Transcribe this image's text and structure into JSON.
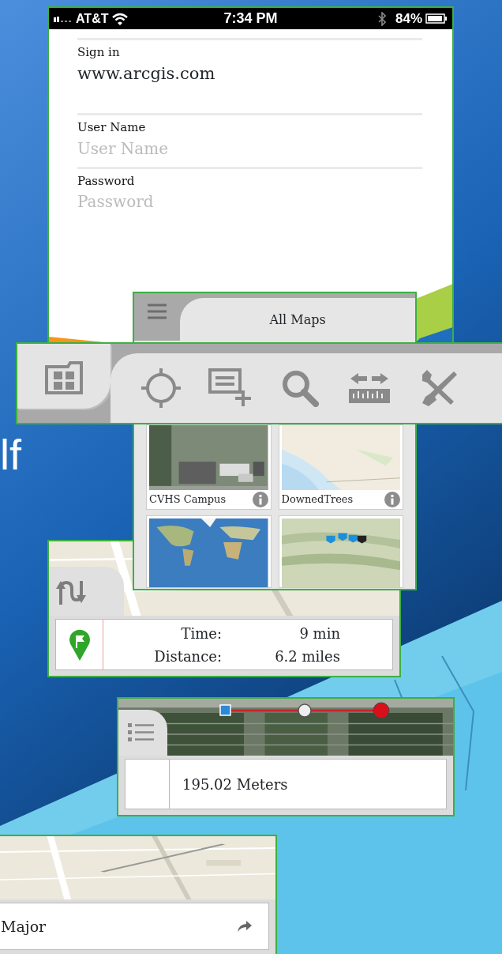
{
  "slide_text": "lf",
  "status_bar": {
    "carrier": "AT&T",
    "time": "7:34 PM",
    "battery": "84%"
  },
  "sign_in": {
    "label": "Sign in",
    "portal": "www.arcgis.com",
    "fields": [
      {
        "label": "User Name",
        "placeholder": "User Name"
      },
      {
        "label": "Password",
        "placeholder": "Password"
      }
    ]
  },
  "maps_panel": {
    "title": "All Maps",
    "maps": [
      {
        "title": "CVHS Campus",
        "kind": "satellite"
      },
      {
        "title": "DownedTrees",
        "kind": "coast"
      },
      {
        "kind": "world"
      },
      {
        "kind": "terrain"
      }
    ]
  },
  "toolbar": {
    "tools": [
      {
        "kind": "gallery",
        "selected": true
      },
      {
        "kind": "locate",
        "selected": false
      },
      {
        "kind": "add-note",
        "selected": false
      },
      {
        "kind": "search",
        "selected": false
      },
      {
        "kind": "measure",
        "selected": false
      },
      {
        "kind": "tools",
        "selected": false
      }
    ]
  },
  "directions": {
    "rows": [
      {
        "label": "Time:",
        "value": "9 min"
      },
      {
        "label": "Distance:",
        "value": "6.2 miles"
      }
    ]
  },
  "measure": {
    "result": "195.02 Meters"
  },
  "route_step": {
    "text": "Major"
  }
}
